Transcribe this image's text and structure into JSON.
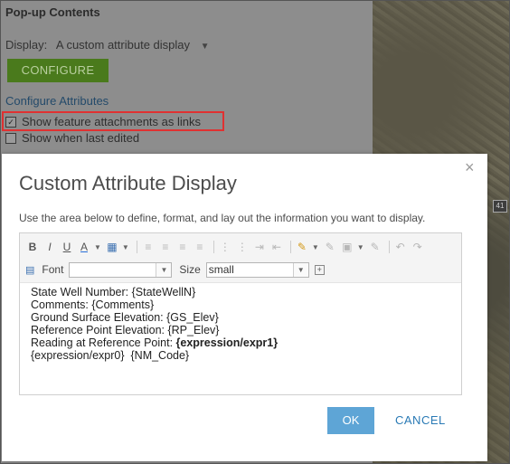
{
  "background": {
    "title": "Pop-up Contents",
    "display_label": "Display:",
    "display_value": "A custom attribute display",
    "configure_button": "CONFIGURE",
    "configure_attributes_link": "Configure Attributes",
    "checkbox_attachments": "Show feature attachments as links",
    "checkbox_last_edited": "Show when last edited",
    "map_shield": "41"
  },
  "dialog": {
    "title": "Custom Attribute Display",
    "close": "×",
    "description": "Use the area below to define, format, and lay out the information you want to display.",
    "toolbar": {
      "font_label": "Font",
      "font_value": "",
      "size_label": "Size",
      "size_value": "small"
    },
    "content": {
      "line1": "State Well Number: {StateWellN}",
      "line2": "Comments: {Comments}",
      "line3": "Ground Surface Elevation: {GS_Elev}",
      "line4": "Reference Point Elevation: {RP_Elev}",
      "line5_prefix": "Reading at Reference Point: ",
      "line5_bold": "{expression/expr1}",
      "line6": "{expression/expr0}  {NM_Code}"
    },
    "ok_button": "OK",
    "cancel_button": "CANCEL"
  }
}
